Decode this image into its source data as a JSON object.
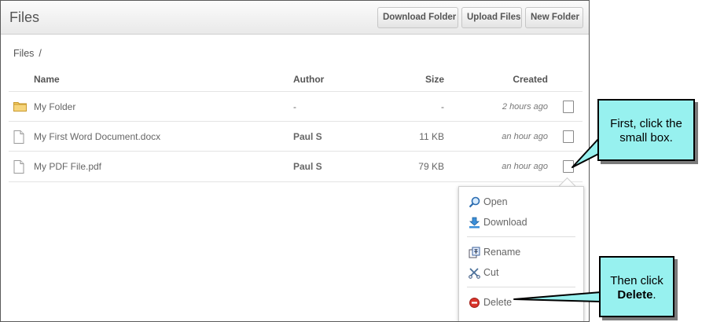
{
  "header": {
    "title": "Files",
    "buttons": [
      "Download Folder",
      "Upload Files",
      "New Folder"
    ]
  },
  "breadcrumb": {
    "root": "Files",
    "separator": "/"
  },
  "table": {
    "columns": [
      "Name",
      "Author",
      "Size",
      "Created"
    ],
    "rows": [
      {
        "icon": "folder-icon",
        "name": "My Folder",
        "author": "-",
        "size": "-",
        "created": "2 hours ago"
      },
      {
        "icon": "document-icon",
        "name": "My First Word Document.docx",
        "author": "Paul S",
        "size": "11 KB",
        "created": "an hour ago"
      },
      {
        "icon": "document-icon",
        "name": "My PDF File.pdf",
        "author": "Paul S",
        "size": "79 KB",
        "created": "an hour ago"
      }
    ]
  },
  "context_menu": {
    "items": [
      {
        "label": "Open",
        "icon": "magnifier-icon"
      },
      {
        "label": "Download",
        "icon": "download-arrow-icon"
      },
      {
        "label": "Rename",
        "icon": "rename-icon"
      },
      {
        "label": "Cut",
        "icon": "scissors-icon"
      },
      {
        "label": "Delete",
        "icon": "delete-circle-icon"
      }
    ]
  },
  "callouts": {
    "first": "First, click the small box.",
    "second_prefix": "Then click",
    "second_bold": "Delete",
    "second_suffix": "."
  },
  "colors": {
    "callout_bg": "#97f1ef",
    "delete_red": "#d9342b",
    "folder": "#f0c75e"
  }
}
